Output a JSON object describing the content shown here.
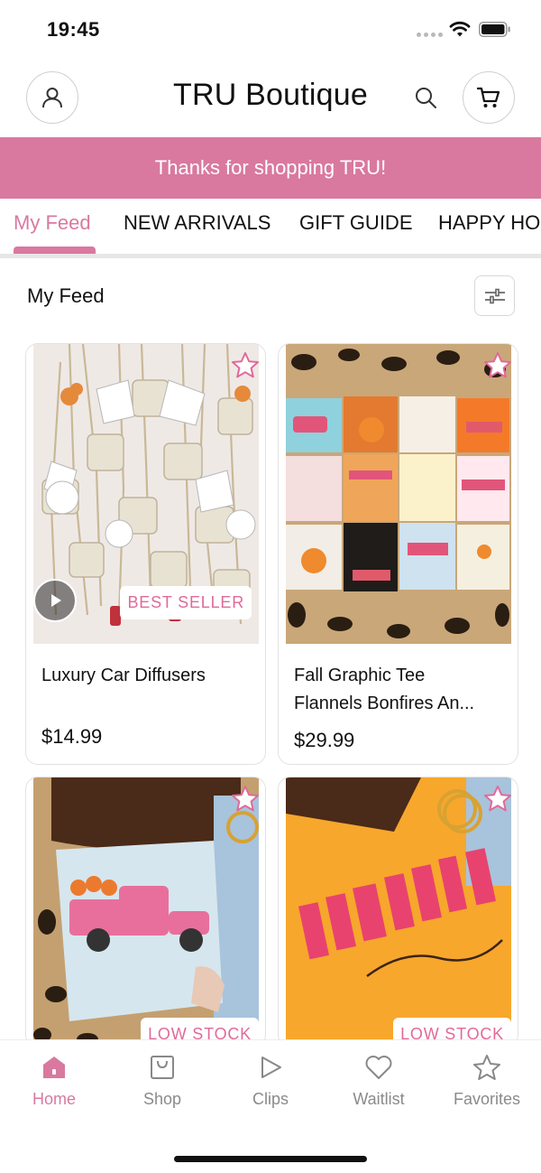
{
  "status_bar": {
    "time": "19:45"
  },
  "header": {
    "title": "TRU Boutique"
  },
  "promo": {
    "text": "Thanks for shopping TRU!"
  },
  "tabs": [
    {
      "label": "My Feed",
      "active": true
    },
    {
      "label": "NEW ARRIVALS",
      "active": false
    },
    {
      "label": "GIFT GUIDE",
      "active": false
    },
    {
      "label": "HAPPY HOUR",
      "active": false
    }
  ],
  "feed": {
    "title": "My Feed",
    "products": [
      {
        "name": "Luxury Car Diffusers",
        "price": "$14.99",
        "badge": "BEST SELLER",
        "has_video": true
      },
      {
        "name_line1": "Fall Graphic Tee",
        "name_line2": "Flannels Bonfires An...",
        "price": "$29.99",
        "badge": ""
      },
      {
        "name": "",
        "price": "",
        "badge": "LOW STOCK"
      },
      {
        "name": "",
        "price": "",
        "badge": "LOW STOCK"
      }
    ]
  },
  "bottom_nav": [
    {
      "label": "Home",
      "icon": "home-icon",
      "active": true
    },
    {
      "label": "Shop",
      "icon": "shopping-bag-icon",
      "active": false
    },
    {
      "label": "Clips",
      "icon": "play-icon",
      "active": false
    },
    {
      "label": "Waitlist",
      "icon": "heart-icon",
      "active": false
    },
    {
      "label": "Favorites",
      "icon": "star-icon",
      "active": false
    }
  ],
  "colors": {
    "accent": "#d9799f",
    "badge_text": "#e06a99"
  }
}
